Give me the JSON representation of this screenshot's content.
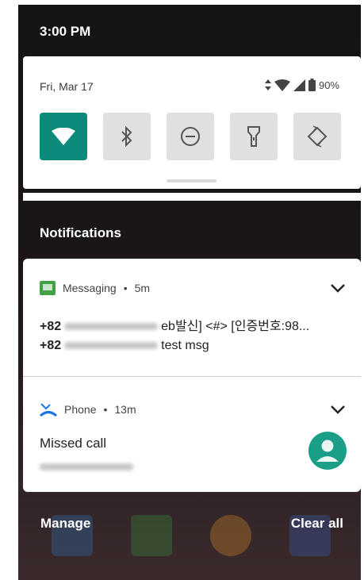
{
  "status_bar": {
    "time": "3:00 PM"
  },
  "quick_settings": {
    "date": "Fri, Mar 17",
    "battery": "90%",
    "tiles": [
      "wifi-icon",
      "bluetooth-icon",
      "do-not-disturb-icon",
      "flashlight-icon",
      "auto-rotate-icon"
    ]
  },
  "notifications": {
    "header": "Notifications",
    "items": [
      {
        "app": "Messaging",
        "time": "5m",
        "lines": [
          {
            "prefix": "+82",
            "text": "eb발신] <#> [인증번호:98..."
          },
          {
            "prefix": "+82",
            "text": "test msg"
          }
        ]
      },
      {
        "app": "Phone",
        "time": "13m",
        "title": "Missed call"
      }
    ]
  },
  "footer": {
    "manage": "Manage",
    "clear_all": "Clear all"
  },
  "colors": {
    "accent": "#0b8a7a",
    "phone_blue": "#1a73e8",
    "messaging_green": "#43a047"
  }
}
